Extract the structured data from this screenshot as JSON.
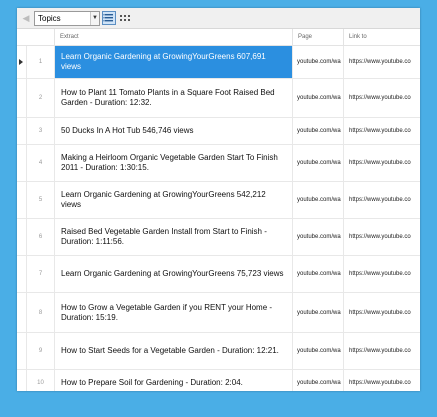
{
  "toolbar": {
    "back_icon": "chevron-left-icon",
    "dropdown_value": "Topics",
    "list_icon": "list-view-icon",
    "grid_icon": "grid-view-icon",
    "colors": {
      "active_bg": "#cfe3f7",
      "active_border": "#5b8ec2"
    }
  },
  "table": {
    "headers": {
      "extract": "Extract",
      "page": "Page",
      "link": "Link to"
    },
    "rows": [
      {
        "num": "1",
        "extract": "Learn Organic Gardening at GrowingYourGreens 607,691 views",
        "page": "youtube.com/wa",
        "link": "https://www.youtube.co"
      },
      {
        "num": "2",
        "extract": "How to Plant 11 Tomato Plants in a Square Foot Raised Bed Garden - Duration: 12:32.",
        "page": "youtube.com/wa",
        "link": "https://www.youtube.co"
      },
      {
        "num": "3",
        "extract": "50 Ducks In A Hot Tub 546,746 views",
        "page": "youtube.com/wa",
        "link": "https://www.youtube.co"
      },
      {
        "num": "4",
        "extract": "Making a Heirloom Organic Vegetable Garden Start To Finish 2011 - Duration: 1:30:15.",
        "page": "youtube.com/wa",
        "link": "https://www.youtube.co"
      },
      {
        "num": "5",
        "extract": "Learn Organic Gardening at GrowingYourGreens 542,212 views",
        "page": "youtube.com/wa",
        "link": "https://www.youtube.co"
      },
      {
        "num": "6",
        "extract": "Raised Bed Vegetable Garden Install from Start to Finish - Duration: 1:11:56.",
        "page": "youtube.com/wa",
        "link": "https://www.youtube.co"
      },
      {
        "num": "7",
        "extract": "Learn Organic Gardening at GrowingYourGreens 75,723 views",
        "page": "youtube.com/wa",
        "link": "https://www.youtube.co"
      },
      {
        "num": "8",
        "extract": "How to Grow a Vegetable Garden if you RENT your Home - Duration: 15:19.",
        "page": "youtube.com/wa",
        "link": "https://www.youtube.co"
      },
      {
        "num": "9",
        "extract": "How to Start Seeds for a Vegetable Garden - Duration: 12:21.",
        "page": "youtube.com/wa",
        "link": "https://www.youtube.co"
      },
      {
        "num": "10",
        "extract": "How to Prepare Soil for Gardening - Duration: 2:04.",
        "page": "youtube.com/wa",
        "link": "https://www.youtube.co"
      }
    ],
    "selected_row": 0,
    "colors": {
      "selected_bg": "#2b8fe0",
      "selected_text": "#ffffff"
    }
  }
}
